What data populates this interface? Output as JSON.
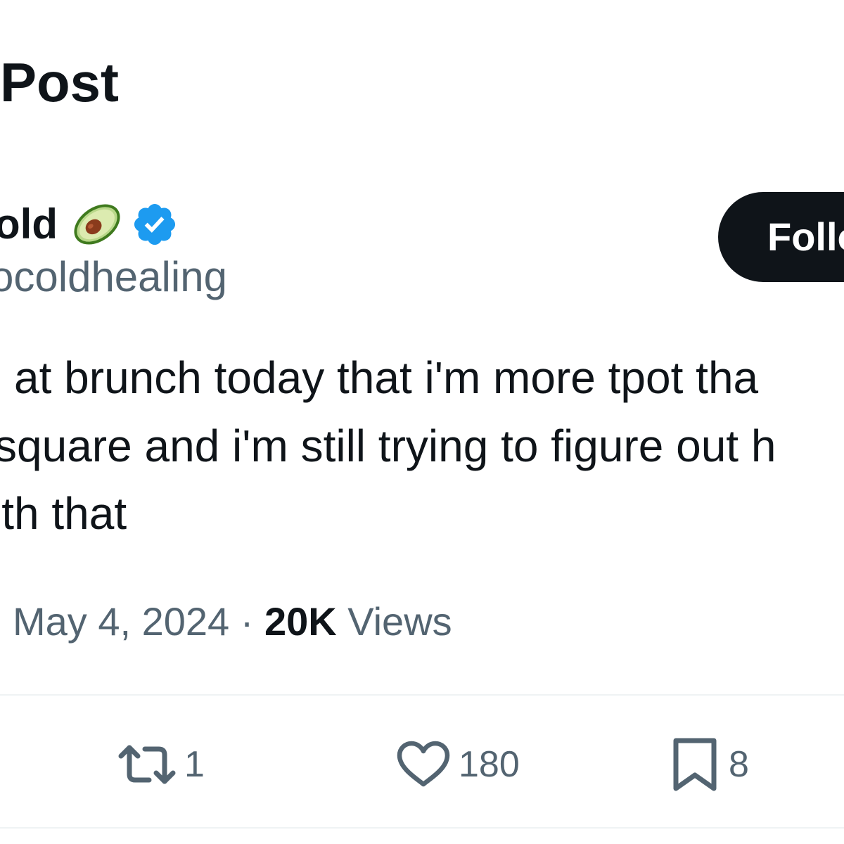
{
  "header": {
    "title": "Post"
  },
  "author": {
    "display_name": "old",
    "emoji_icon": "avocado-icon",
    "badge_icon": "verified-badge-icon",
    "handle": "ocoldhealing",
    "follow_label": "Follo"
  },
  "tweet": {
    "lines": [
      "at brunch today that i'm more tpot tha",
      "square and i'm still trying to figure out h",
      "ith that"
    ]
  },
  "meta": {
    "date": "May 4, 2024",
    "separator": " · ",
    "views_count": "20K",
    "views_label": " Views"
  },
  "actions": {
    "repost_count": "1",
    "like_count": "180",
    "bookmark_count": "8"
  },
  "colors": {
    "text_primary": "#0f1419",
    "text_secondary": "#536471",
    "verified_blue": "#1d9bf0",
    "divider": "#eff3f4",
    "avocado_green": "#5c9e31"
  }
}
